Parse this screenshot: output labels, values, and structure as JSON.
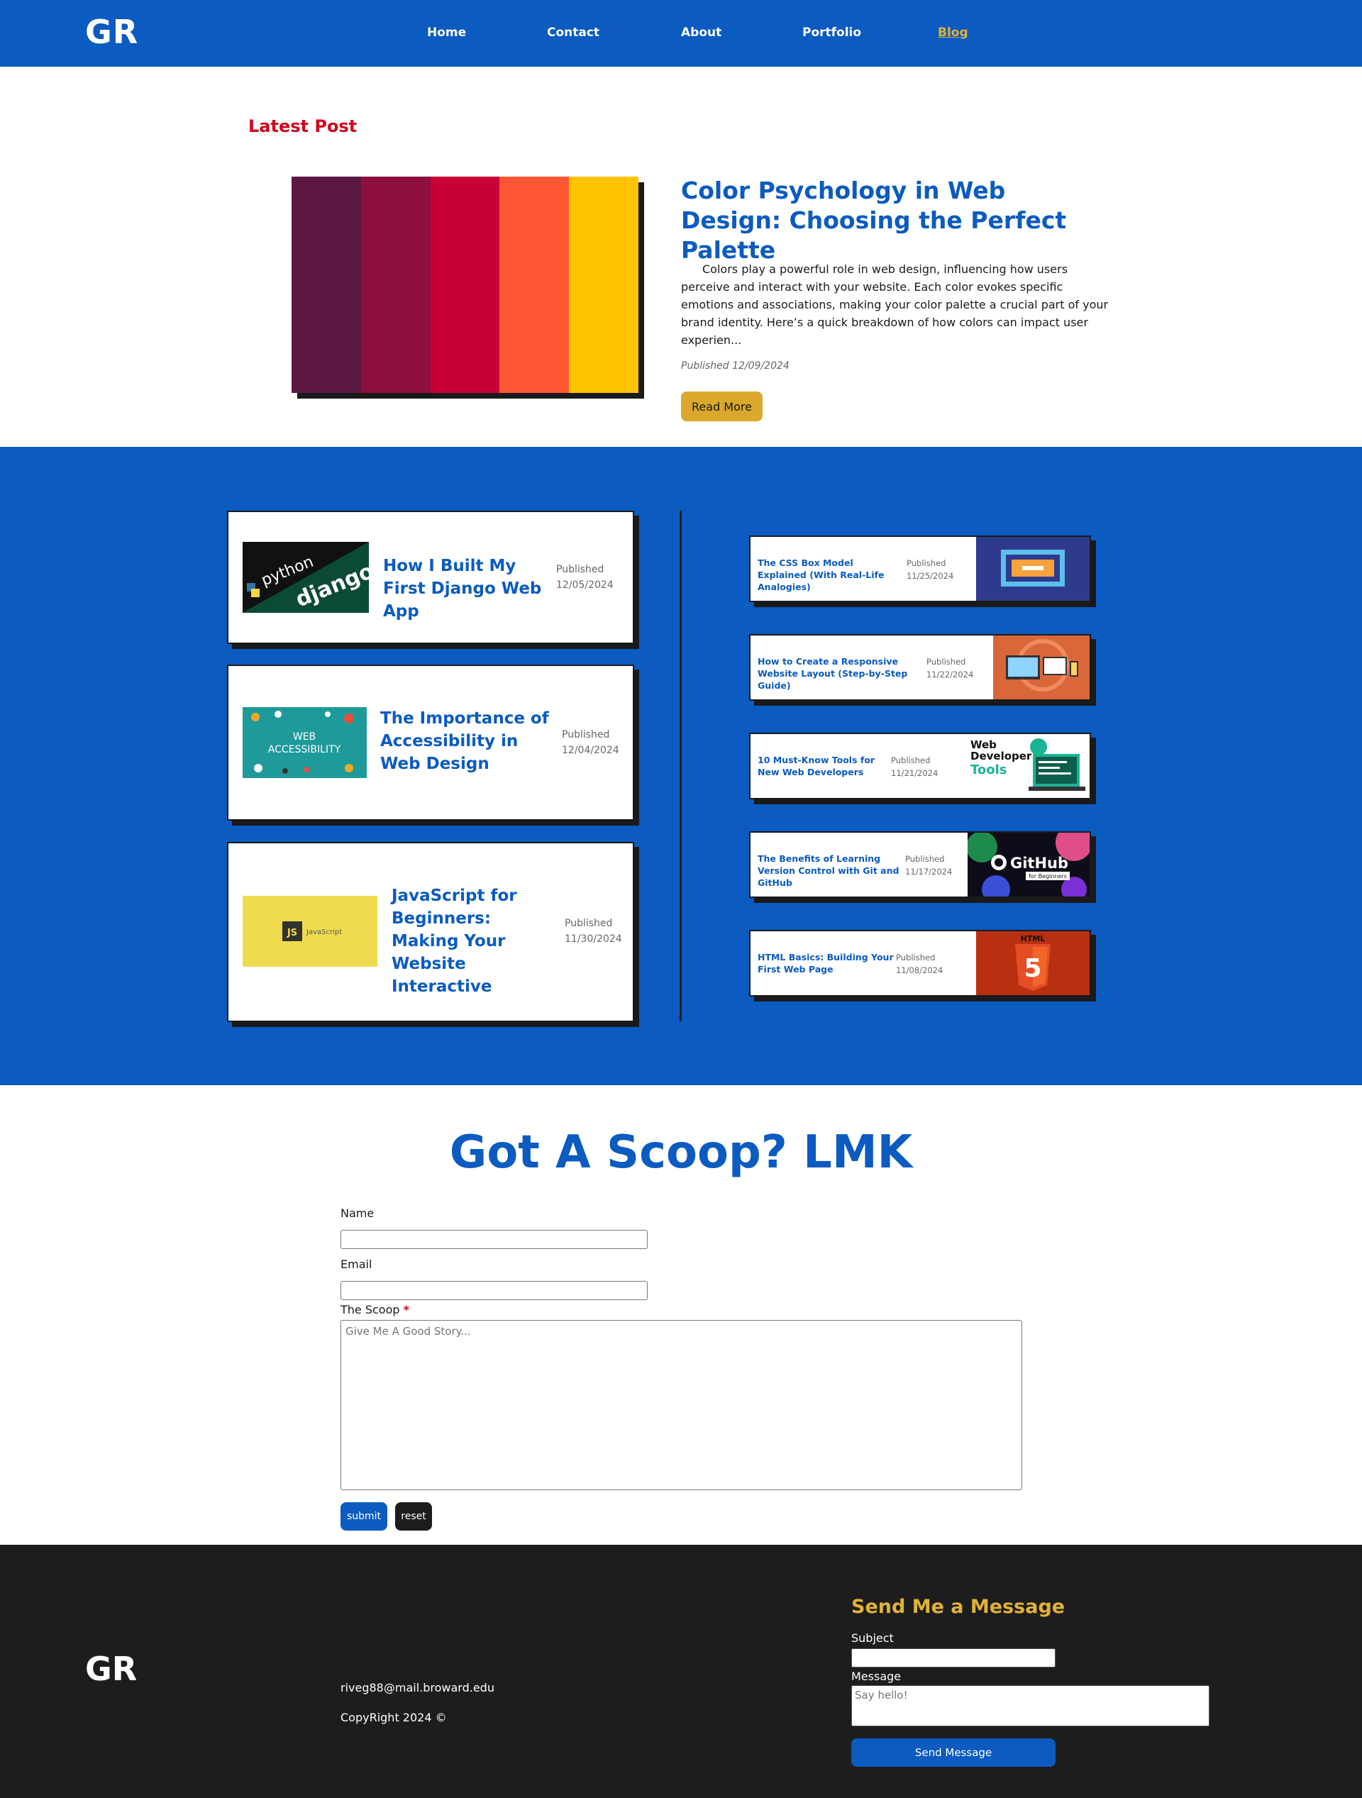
{
  "site": {
    "logo": "GR"
  },
  "nav": {
    "items": [
      "Home",
      "Contact",
      "About",
      "Portfolio",
      "Blog"
    ],
    "active": "Blog",
    "active_color": "#e2b236"
  },
  "latest": {
    "label": "Latest Post",
    "title": "Color Psychology in Web Design: Choosing the Perfect Palette",
    "excerpt": "Colors play a powerful role in web design, influencing how users perceive and interact with your website. Each color evokes specific emotions and associations, making your color palette a crucial part of your brand identity. Here’s a quick breakdown of how colors can impact user experien...",
    "date": "Published 12/09/2024",
    "button": "Read More",
    "palette": [
      "#5a1843",
      "#8e0f3f",
      "#c80038",
      "#ff5733",
      "#ffc300"
    ]
  },
  "posts_left": [
    {
      "title": "How I Built My First Django Web App",
      "published": "Published",
      "date": "12/05/2024",
      "thumb": "python-django-logo",
      "thumb_text": [
        "python",
        "django"
      ]
    },
    {
      "title": "The Importance of Accessibility in Web Design",
      "published": "Published",
      "date": "12/04/2024",
      "thumb": "web-accessibility-illustration",
      "thumb_text": [
        "WEB",
        "ACCESSIBILITY"
      ]
    },
    {
      "title": "JavaScript for Beginners: Making Your Website Interactive",
      "published": "Published",
      "date": "11/30/2024",
      "thumb": "javascript-logo",
      "thumb_text": [
        "JS",
        "JavaScript"
      ]
    }
  ],
  "posts_right": [
    {
      "title": "The CSS Box Model Explained (With Real-Life Analogies)",
      "published": "Published",
      "date": "11/25/2024",
      "thumb": "css-box-model-diagram"
    },
    {
      "title": "How to Create a Responsive Website Layout (Step-by-Step Guide)",
      "published": "Published",
      "date": "11/22/2024",
      "thumb": "responsive-devices-illustration"
    },
    {
      "title": "10 Must-Know Tools for New Web Developers",
      "published": "Published",
      "date": "11/21/2024",
      "thumb": "web-developer-tools-illustration",
      "thumb_text": [
        "Web",
        "Developer",
        "Tools"
      ]
    },
    {
      "title": "The Benefits of Learning Version Control with Git and GitHub",
      "published": "Published",
      "date": "11/17/2024",
      "thumb": "github-logo",
      "thumb_text": [
        "GitHub",
        "for Beginners"
      ]
    },
    {
      "title": "HTML Basics: Building Your First Web Page",
      "published": "Published",
      "date": "11/08/2024",
      "thumb": "html5-logo",
      "thumb_text": [
        "HTML",
        "5"
      ]
    }
  ],
  "form": {
    "title": "Got A Scoop? LMK",
    "name_label": "Name",
    "email_label": "Email",
    "scoop_label": "The Scoop",
    "required_mark": "*",
    "scoop_placeholder": "Give Me A Good Story...",
    "submit": "submit",
    "reset": "reset"
  },
  "footer": {
    "logo": "GR",
    "email": "riveg88@mail.broward.edu",
    "copyright": "CopyRight 2024 ©",
    "message_title": "Send Me a Message",
    "subject_label": "Subject",
    "message_label": "Message",
    "message_placeholder": "Say hello!",
    "send_button": "Send Message"
  }
}
